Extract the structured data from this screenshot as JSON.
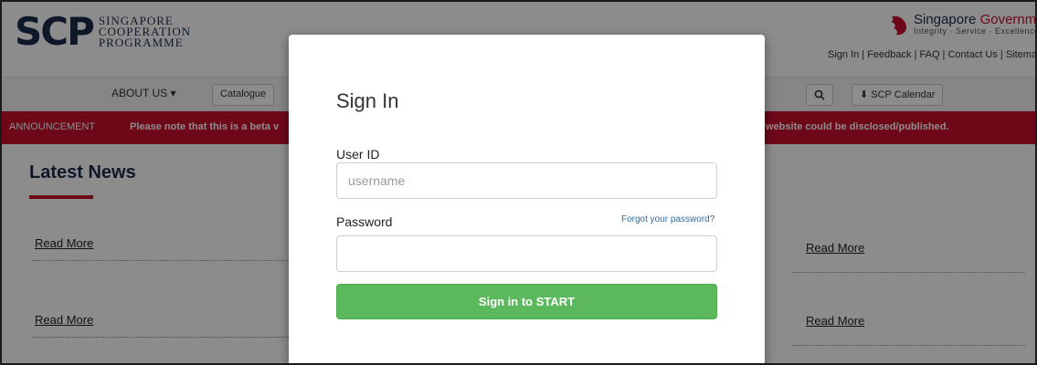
{
  "header": {
    "logo_mark": "SCP",
    "logo_lines": [
      "SINGAPORE",
      "COOPERATION",
      "PROGRAMME"
    ],
    "gov_title_a": "Singapore ",
    "gov_title_b": "Government",
    "gov_tagline": "Integrity · Service · Excellence",
    "top_links": "Sign In | Feedback | FAQ | Contact Us | Sitemap"
  },
  "nav": {
    "about": "ABOUT US ▾",
    "catalogue": "Catalogue",
    "calendar": "SCP Calendar"
  },
  "announcement": {
    "label": "ANNOUNCEMENT",
    "text_left": "Please note that this is a beta v",
    "text_right": "website could be disclosed/published."
  },
  "content": {
    "news_title": "Latest News",
    "read_more": "Read More"
  },
  "modal": {
    "title": "Sign In",
    "user_label": "User ID",
    "user_placeholder": "username",
    "user_value": "",
    "password_label": "Password",
    "password_value": "",
    "forgot": "Forgot your password?",
    "submit": "Sign in to START"
  },
  "colors": {
    "brand_red": "#c8102e",
    "brand_navy": "#1c2d4a",
    "button_green": "#5cb85c"
  }
}
